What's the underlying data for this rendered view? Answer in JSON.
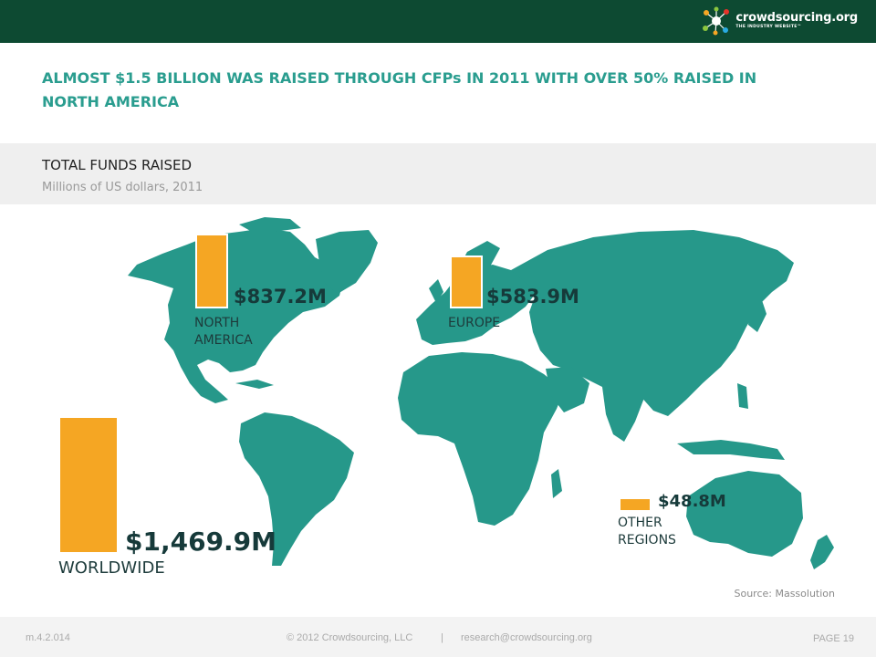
{
  "header": {
    "logo_name": "crowdsourcing.org",
    "logo_tagline": "THE INDUSTRY WEBSITE™"
  },
  "headline": "ALMOST $1.5 BILLION WAS RAISED THROUGH CFPs IN 2011 WITH OVER 50% RAISED IN NORTH AMERICA",
  "panel": {
    "title": "TOTAL FUNDS RAISED",
    "subtitle": "Millions of US dollars, 2011"
  },
  "colors": {
    "bar": "#f5a623",
    "map": "#26988a",
    "header": "#0d4a32",
    "headline": "#2a9d8f"
  },
  "chart_data": {
    "type": "bar",
    "title": "TOTAL FUNDS RAISED",
    "subtitle": "Millions of US dollars, 2011",
    "categories": [
      "NORTH AMERICA",
      "EUROPE",
      "OTHER REGIONS",
      "WORLDWIDE"
    ],
    "values": [
      837.2,
      583.9,
      48.8,
      1469.9
    ],
    "value_labels": [
      "$837.2M",
      "$583.9M",
      "$48.8M",
      "$1,469.9M"
    ],
    "region_labels": [
      "NORTH\nAMERICA",
      "EUROPE",
      "OTHER\nREGIONS",
      "WORLDWIDE"
    ],
    "unit": "Millions of US dollars"
  },
  "source": "Source: Massolution",
  "footer": {
    "code": "m.4.2.014",
    "copyright": "© 2012 Crowdsourcing, LLC",
    "separator": "|",
    "email": "research@crowdsourcing.org",
    "page": "PAGE 19"
  }
}
